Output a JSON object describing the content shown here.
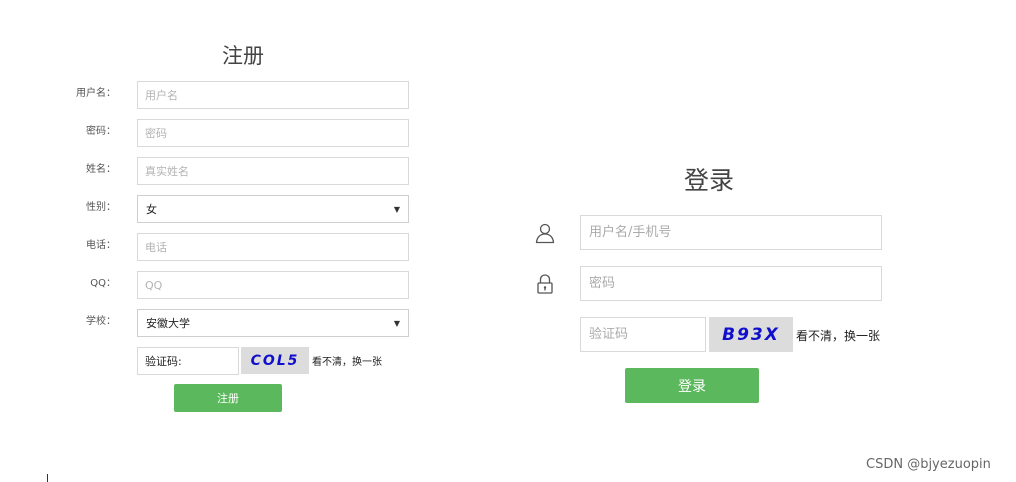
{
  "register": {
    "title": "注册",
    "fields": [
      {
        "label": "用户名：",
        "placeholder": "用户名"
      },
      {
        "label": "密码：",
        "placeholder": "密码"
      },
      {
        "label": "姓名：",
        "placeholder": "真实姓名"
      },
      {
        "label": "性别：",
        "value": "女"
      },
      {
        "label": "电话：",
        "placeholder": "电话"
      },
      {
        "label": "QQ：",
        "placeholder": "QQ"
      },
      {
        "label": "学校：",
        "value": "安徽大学"
      }
    ],
    "captcha_input_value": "验证码:",
    "captcha_code": "COL5",
    "refresh_text": "看不清，换一张",
    "submit_label": "注册"
  },
  "login": {
    "title": "登录",
    "username_placeholder": "用户名/手机号",
    "password_placeholder": "密码",
    "captcha_placeholder": "验证码",
    "captcha_code": "B93X",
    "refresh_text": "看不清，换一张",
    "submit_label": "登录"
  },
  "watermark": "CSDN @bjyezuopin",
  "colors": {
    "button": "#5cb85c",
    "captcha_text": "#1010cc",
    "captcha_bg": "#dcdcdc"
  }
}
